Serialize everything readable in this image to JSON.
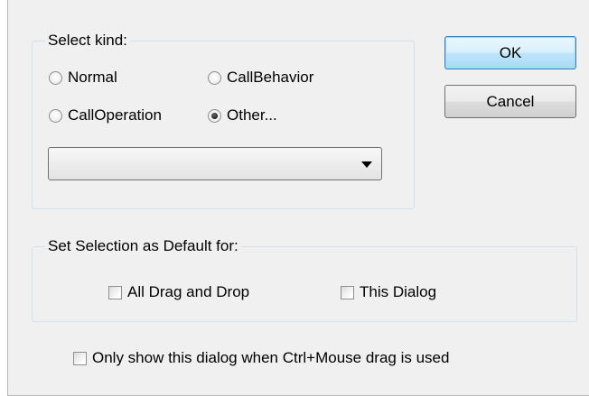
{
  "select_kind": {
    "legend": "Select kind:",
    "options": [
      {
        "label": "Normal",
        "checked": false
      },
      {
        "label": "CallBehavior",
        "checked": false
      },
      {
        "label": "CallOperation",
        "checked": false
      },
      {
        "label": "Other...",
        "checked": true
      }
    ],
    "combo_value": ""
  },
  "buttons": {
    "ok": "OK",
    "cancel": "Cancel"
  },
  "default_group": {
    "legend": "Set Selection as Default for:",
    "all_drag_drop": {
      "label": "All Drag and Drop",
      "checked": false
    },
    "this_dialog": {
      "label": "This Dialog",
      "checked": false
    }
  },
  "ctrl_option": {
    "label": "Only show this dialog when Ctrl+Mouse drag is used",
    "checked": false
  },
  "colors": {
    "dialog_bg": "#f0f0f0",
    "default_button_border": "#3c7fb1"
  }
}
